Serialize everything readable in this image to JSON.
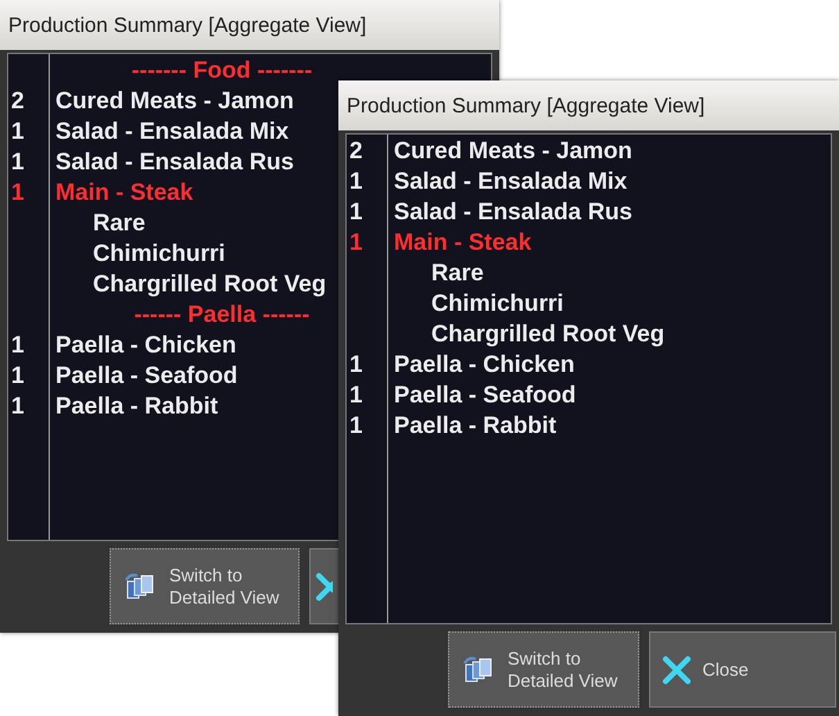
{
  "windows": [
    {
      "title": "Production Summary [Aggregate View]",
      "rows": [
        {
          "kind": "header",
          "label": "------- Food -------"
        },
        {
          "kind": "item",
          "qty": "2",
          "label": "Cured Meats - Jamon",
          "highlighted": false
        },
        {
          "kind": "item",
          "qty": "1",
          "label": "Salad - Ensalada Mix",
          "highlighted": false
        },
        {
          "kind": "item",
          "qty": "1",
          "label": "Salad - Ensalada Rus",
          "highlighted": false
        },
        {
          "kind": "item",
          "qty": "1",
          "label": "Main - Steak",
          "highlighted": true
        },
        {
          "kind": "modifier",
          "label": "Rare"
        },
        {
          "kind": "modifier",
          "label": "Chimichurri"
        },
        {
          "kind": "modifier",
          "label": "Chargrilled Root Veg"
        },
        {
          "kind": "header",
          "label": "------ Paella ------"
        },
        {
          "kind": "item",
          "qty": "1",
          "label": "Paella - Chicken",
          "highlighted": false
        },
        {
          "kind": "item",
          "qty": "1",
          "label": "Paella - Seafood",
          "highlighted": false
        },
        {
          "kind": "item",
          "qty": "1",
          "label": "Paella - Rabbit",
          "highlighted": false
        }
      ],
      "buttons": [
        {
          "kind": "switch",
          "label": "Switch to Detailed View"
        },
        {
          "kind": "close"
        }
      ]
    },
    {
      "title": "Production Summary [Aggregate View]",
      "rows": [
        {
          "kind": "item",
          "qty": "2",
          "label": "Cured Meats - Jamon",
          "highlighted": false
        },
        {
          "kind": "item",
          "qty": "1",
          "label": "Salad - Ensalada Mix",
          "highlighted": false
        },
        {
          "kind": "item",
          "qty": "1",
          "label": "Salad - Ensalada Rus",
          "highlighted": false
        },
        {
          "kind": "item",
          "qty": "1",
          "label": "Main - Steak",
          "highlighted": true
        },
        {
          "kind": "modifier",
          "label": "Rare"
        },
        {
          "kind": "modifier",
          "label": "Chimichurri"
        },
        {
          "kind": "modifier",
          "label": "Chargrilled Root Veg"
        },
        {
          "kind": "item",
          "qty": "1",
          "label": "Paella - Chicken",
          "highlighted": false
        },
        {
          "kind": "item",
          "qty": "1",
          "label": "Paella - Seafood",
          "highlighted": false
        },
        {
          "kind": "item",
          "qty": "1",
          "label": "Paella - Rabbit",
          "highlighted": false
        }
      ],
      "buttons": [
        {
          "kind": "switch",
          "label": "Switch to Detailed View"
        },
        {
          "kind": "close",
          "label": "Close"
        }
      ]
    }
  ]
}
